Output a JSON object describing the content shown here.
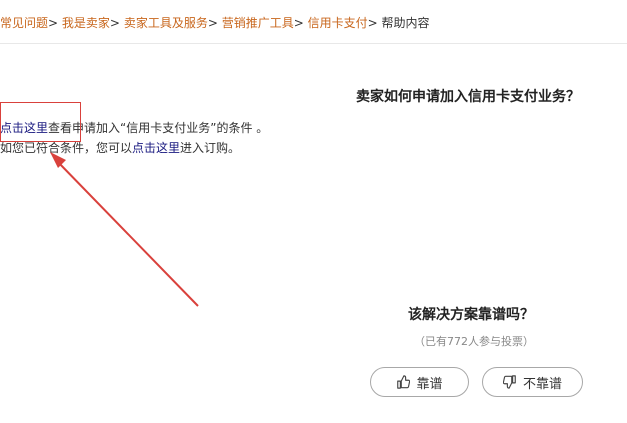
{
  "breadcrumb": {
    "items": [
      "常见问题",
      "我是卖家",
      "卖家工具及服务",
      "营销推广工具",
      "信用卡支付"
    ],
    "separator": ">",
    "current": "帮助内容"
  },
  "question": "卖家如何申请加入信用卡支付业务？",
  "answer": {
    "line1_link": "点击这里",
    "line1_text": "查看申请加入“信用卡支付业务”的条件 。",
    "line2_prefix": "如您已符合条件，您可以",
    "line2_link": "点击这里",
    "line2_suffix": "进入订购。"
  },
  "vote": {
    "title": "该解决方案靠谱吗？",
    "count_text": "（已有772人参与投票）",
    "good_label": "靠谱",
    "bad_label": "不靠谱",
    "good_icon": "thumbs-up-icon",
    "bad_icon": "thumbs-down-icon"
  },
  "colors": {
    "link_orange": "#c8661c",
    "link_blue": "#1a1a80",
    "annotation_red": "#d9413c"
  }
}
